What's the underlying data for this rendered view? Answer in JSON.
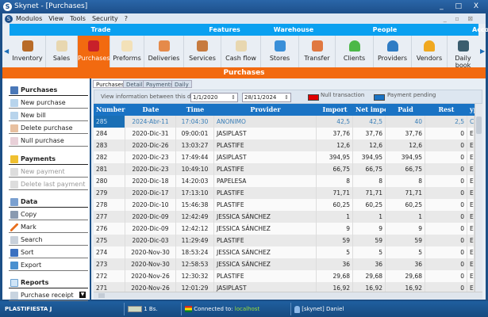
{
  "window": {
    "title": "Skynet - [Purchases]",
    "controls": "_ □ X"
  },
  "menu": [
    "Modulos",
    "View",
    "Tools",
    "Security",
    "?"
  ],
  "ribbon": {
    "groups": [
      "Trade",
      "Features",
      "Warehouse",
      "People",
      "Acco"
    ],
    "buttons": [
      "Inventory",
      "Sales",
      "Purchases",
      "Preforms",
      "Deliveries",
      "Services",
      "Cash flow",
      "Stores",
      "Transfer",
      "Clients",
      "Providers",
      "Vendors",
      "Daily book"
    ],
    "active": "Purchases"
  },
  "section_title": "Purchases",
  "sidebar": {
    "purchases_header": "Purchases",
    "purchases_items": [
      "New purchase",
      "New bill",
      "Delete purchase",
      "Null purchase"
    ],
    "payments_header": "Payments",
    "payments_items": [
      "New payment",
      "Delete last payment"
    ],
    "data_header": "Data",
    "data_items": [
      "Copy",
      "Mark",
      "Search",
      "Sort",
      "Export"
    ],
    "reports_header": "Reports",
    "reports_items": [
      "Purchase receipt"
    ]
  },
  "tabs": [
    "Purchases",
    "Detail",
    "Payments",
    "Daily"
  ],
  "filter": {
    "label": "View information between this dates:",
    "from": "1/1/2020",
    "to": "28/11/2024",
    "legend_null": "Null transaction",
    "legend_pending": "Payment pending",
    "color_null": "#e00000",
    "color_pending": "#1a73c4"
  },
  "table": {
    "columns": [
      "Number",
      "Date",
      "Time",
      "Provider",
      "Import",
      "Net import",
      "Paid",
      "Rest",
      "ype"
    ],
    "rows": [
      [
        "285",
        "2024-Abr-11",
        "17:04:30",
        "ANONIMO",
        "42,5",
        "42,5",
        "40",
        "2,5",
        "C"
      ],
      [
        "284",
        "2020-Dic-31",
        "09:00:01",
        "JASIPLAST",
        "37,76",
        "37,76",
        "37,76",
        "0",
        "El"
      ],
      [
        "283",
        "2020-Dic-26",
        "13:03:27",
        "PLASTIFE",
        "12,6",
        "12,6",
        "12,6",
        "0",
        "El"
      ],
      [
        "282",
        "2020-Dic-23",
        "17:49:44",
        "JASIPLAST",
        "394,95",
        "394,95",
        "394,95",
        "0",
        "El"
      ],
      [
        "281",
        "2020-Dic-23",
        "10:49:10",
        "PLASTIFE",
        "66,75",
        "66,75",
        "66,75",
        "0",
        "El"
      ],
      [
        "280",
        "2020-Dic-18",
        "14:20:03",
        "PAPELESA",
        "8",
        "8",
        "8",
        "0",
        "El"
      ],
      [
        "279",
        "2020-Dic-17",
        "17:13:10",
        "PLASTIFE",
        "71,71",
        "71,71",
        "71,71",
        "0",
        "El"
      ],
      [
        "278",
        "2020-Dic-10",
        "15:46:38",
        "PLASTIFE",
        "60,25",
        "60,25",
        "60,25",
        "0",
        "El"
      ],
      [
        "277",
        "2020-Dic-09",
        "12:42:49",
        "JESSICA SÁNCHEZ",
        "1",
        "1",
        "1",
        "0",
        "El"
      ],
      [
        "276",
        "2020-Dic-09",
        "12:42:12",
        "JESSICA SÁNCHEZ",
        "9",
        "9",
        "9",
        "0",
        "El"
      ],
      [
        "275",
        "2020-Dic-03",
        "11:29:49",
        "PLASTIFE",
        "59",
        "59",
        "59",
        "0",
        "El"
      ],
      [
        "274",
        "2020-Nov-30",
        "18:53:24",
        "JESSICA SÁNCHEZ",
        "5",
        "5",
        "5",
        "0",
        "El"
      ],
      [
        "273",
        "2020-Nov-30",
        "12:58:53",
        "JESSICA SÁNCHEZ",
        "36",
        "36",
        "36",
        "0",
        "El"
      ],
      [
        "272",
        "2020-Nov-26",
        "12:30:32",
        "PLASTIFE",
        "29,68",
        "29,68",
        "29,68",
        "0",
        "El"
      ],
      [
        "271",
        "2020-Nov-26",
        "12:01:29",
        "JASIPLAST",
        "16,92",
        "16,92",
        "16,92",
        "0",
        "El"
      ]
    ]
  },
  "status": {
    "company": "PLASTIFIESTA J",
    "currency": "1 Bs.",
    "connected_label": "Connected to:",
    "host": "localhost",
    "user": "[skynet] Daniel"
  }
}
